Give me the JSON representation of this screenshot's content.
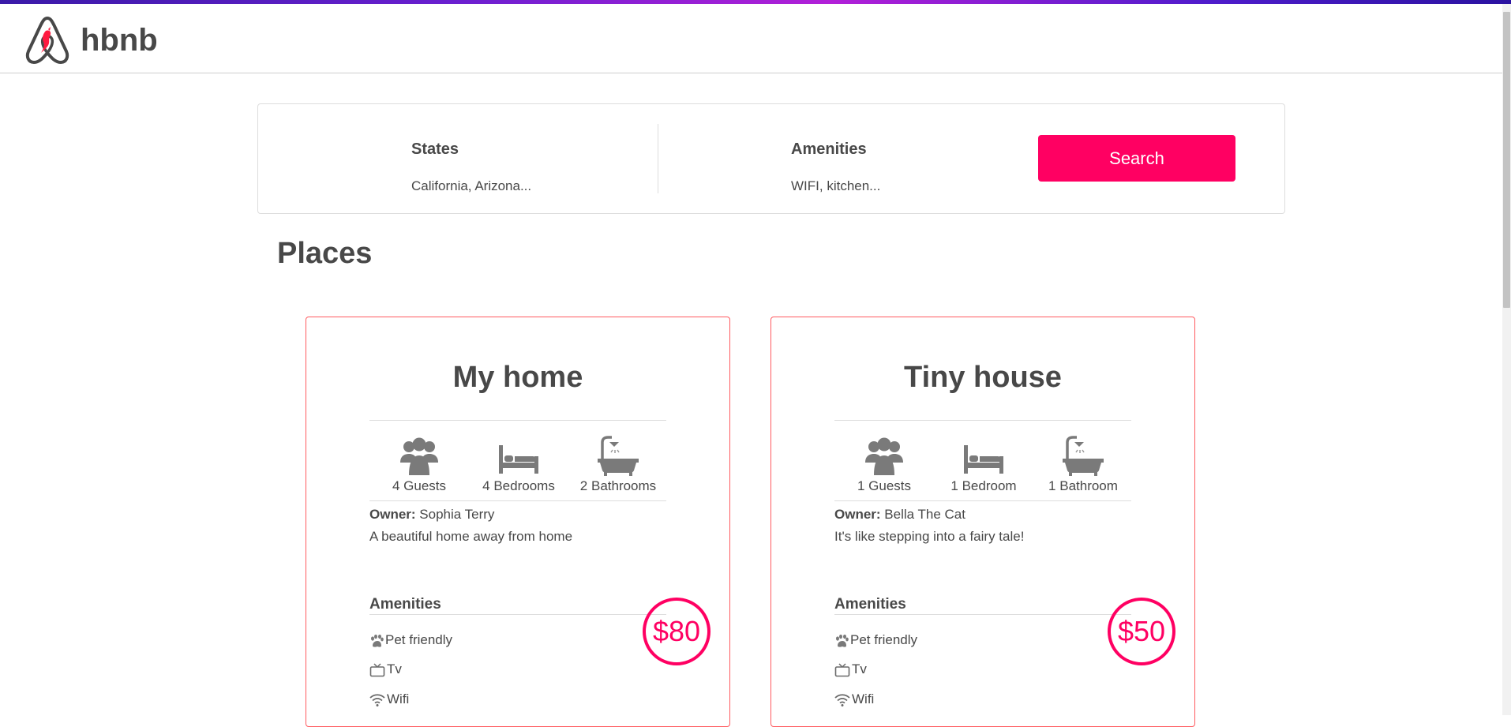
{
  "brand": {
    "name": "hbnb",
    "logo_icon": "airbnb-logo-icon"
  },
  "colors": {
    "accent": "#ff0062",
    "card_border": "#ff5a5f",
    "text": "#484848",
    "divider": "#dddddd"
  },
  "filters": {
    "states": {
      "title": "States",
      "value": "California, Arizona..."
    },
    "amenities": {
      "title": "Amenities",
      "value": "WIFI, kitchen..."
    },
    "search_label": "Search"
  },
  "places_title": "Places",
  "places": [
    {
      "name": "My home",
      "guests": "4 Guests",
      "bedrooms": "4 Bedrooms",
      "bathrooms": "2 Bathrooms",
      "owner_label": "Owner:",
      "owner": "Sophia Terry",
      "description": "A beautiful home away from home",
      "amenities_title": "Amenities",
      "amenities": [
        {
          "label": "Pet friendly",
          "icon": "paw-icon"
        },
        {
          "label": "Tv",
          "icon": "tv-icon"
        },
        {
          "label": "Wifi",
          "icon": "wifi-icon"
        }
      ],
      "price": "$80"
    },
    {
      "name": "Tiny house",
      "guests": "1 Guests",
      "bedrooms": "1 Bedroom",
      "bathrooms": "1 Bathroom",
      "owner_label": "Owner:",
      "owner": "Bella The Cat",
      "description": "It's like stepping into a fairy tale!",
      "amenities_title": "Amenities",
      "amenities": [
        {
          "label": "Pet friendly",
          "icon": "paw-icon"
        },
        {
          "label": "Tv",
          "icon": "tv-icon"
        },
        {
          "label": "Wifi",
          "icon": "wifi-icon"
        }
      ],
      "price": "$50"
    }
  ]
}
